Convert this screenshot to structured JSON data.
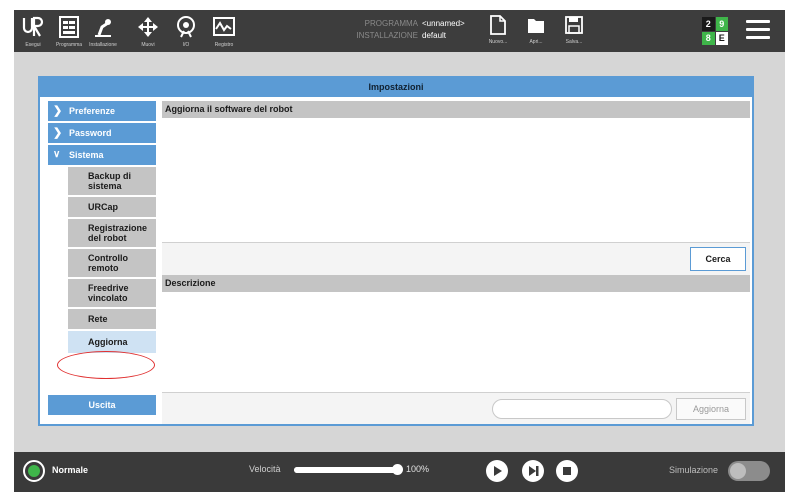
{
  "topbar": {
    "items": [
      {
        "label": "Esegui",
        "icon": "ur-logo-icon"
      },
      {
        "label": "Programma",
        "icon": "program-icon"
      },
      {
        "label": "Installazione",
        "icon": "installation-icon"
      },
      {
        "label": "Muovi",
        "icon": "move-icon"
      },
      {
        "label": "I/O",
        "icon": "io-icon"
      },
      {
        "label": "Registro",
        "icon": "log-icon"
      }
    ],
    "program_key": "PROGRAMMA",
    "program_value": "<unnamed>",
    "installation_key": "INSTALLAZIONE",
    "installation_value": "default",
    "file_buttons": [
      {
        "label": "Nuovo...",
        "icon": "new-file-icon"
      },
      {
        "label": "Apri...",
        "icon": "open-folder-icon"
      },
      {
        "label": "Salva...",
        "icon": "save-icon"
      }
    ],
    "io_status": [
      {
        "text": "2",
        "bg": "#1a1a1a",
        "fg": "#ffffff"
      },
      {
        "text": "9",
        "bg": "#3fb54a",
        "fg": "#ffffff"
      },
      {
        "text": "8",
        "bg": "#3fb54a",
        "fg": "#ffffff"
      },
      {
        "text": "E",
        "bg": "#ffffff",
        "fg": "#1a1a1a"
      }
    ]
  },
  "dialog": {
    "title": "Impostazioni",
    "nav": {
      "preferences": "Preferenze",
      "password": "Password",
      "system": "Sistema",
      "sub_items": [
        "Backup di sistema",
        "URCap",
        "Registrazione del robot",
        "Controllo remoto",
        "Freedrive vincolato",
        "Rete",
        "Aggiorna"
      ],
      "selected": "Aggiorna",
      "exit": "Uscita"
    },
    "content": {
      "update_header": "Aggiorna il software del robot",
      "search_button": "Cerca",
      "description_header": "Descrizione",
      "update_field_value": "",
      "update_button": "Aggiorna"
    }
  },
  "footer": {
    "status": "Normale",
    "status_color": "#3fb54a",
    "speed_label": "Velocità",
    "speed_value": "100%",
    "speed_fraction": 1.0,
    "controls": [
      "play-icon",
      "step-icon",
      "stop-icon"
    ],
    "simulation_label": "Simulazione"
  },
  "colors": {
    "accent": "#5b9bd5",
    "topbar": "#3d3d3d",
    "footer": "#3a3a3a",
    "highlight": "#e03030"
  }
}
